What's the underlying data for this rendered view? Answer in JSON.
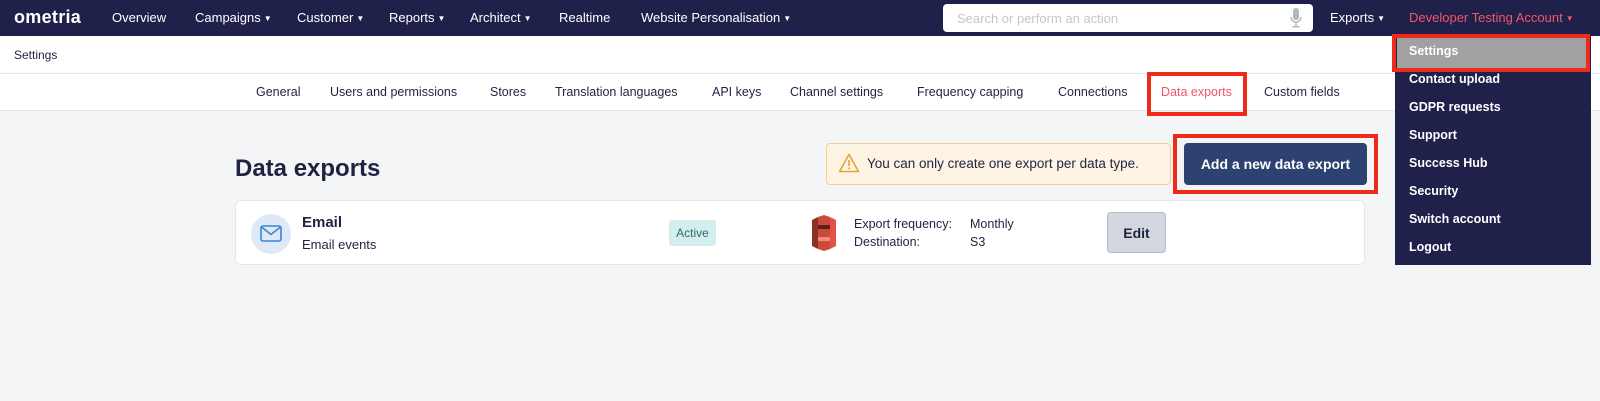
{
  "app": {
    "logo_text": "ometria"
  },
  "topnav": {
    "items": [
      {
        "label": "Overview",
        "has_caret": false
      },
      {
        "label": "Campaigns",
        "has_caret": true
      },
      {
        "label": "Customer",
        "has_caret": true
      },
      {
        "label": "Reports",
        "has_caret": true
      },
      {
        "label": "Architect",
        "has_caret": true
      },
      {
        "label": "Realtime",
        "has_caret": false
      },
      {
        "label": "Website Personalisation",
        "has_caret": true
      }
    ],
    "search_placeholder": "Search or perform an action",
    "exports_label": "Exports",
    "account_label": "Developer Testing Account"
  },
  "breadcrumb": "Settings",
  "tabs": [
    {
      "label": "General"
    },
    {
      "label": "Users and permissions"
    },
    {
      "label": "Stores"
    },
    {
      "label": "Translation languages"
    },
    {
      "label": "API keys"
    },
    {
      "label": "Channel settings"
    },
    {
      "label": "Frequency capping"
    },
    {
      "label": "Connections"
    },
    {
      "label": "Data exports",
      "active": true
    },
    {
      "label": "Custom fields"
    }
  ],
  "main": {
    "title": "Data exports",
    "warning_text": "You can only create one export per data type.",
    "add_button_label": "Add a new data export"
  },
  "exports": [
    {
      "name": "Email",
      "subtitle": "Email events",
      "status": "Active",
      "frequency_label": "Export frequency:",
      "frequency_value": "Monthly",
      "destination_label": "Destination:",
      "destination_value": "S3",
      "edit_label": "Edit"
    }
  ],
  "account_menu": {
    "items": [
      {
        "label": "Settings",
        "selected": true
      },
      {
        "label": "Contact upload"
      },
      {
        "label": "GDPR requests"
      },
      {
        "label": "Support"
      },
      {
        "label": "Success Hub"
      },
      {
        "label": "Security"
      },
      {
        "label": "Switch account"
      },
      {
        "label": "Logout"
      }
    ]
  },
  "colors": {
    "nav_bg": "#20214a",
    "accent": "#f2556c",
    "primary_button": "#2e4272",
    "highlight_box": "#ee2a1a",
    "badge_bg": "#d4eeee"
  }
}
